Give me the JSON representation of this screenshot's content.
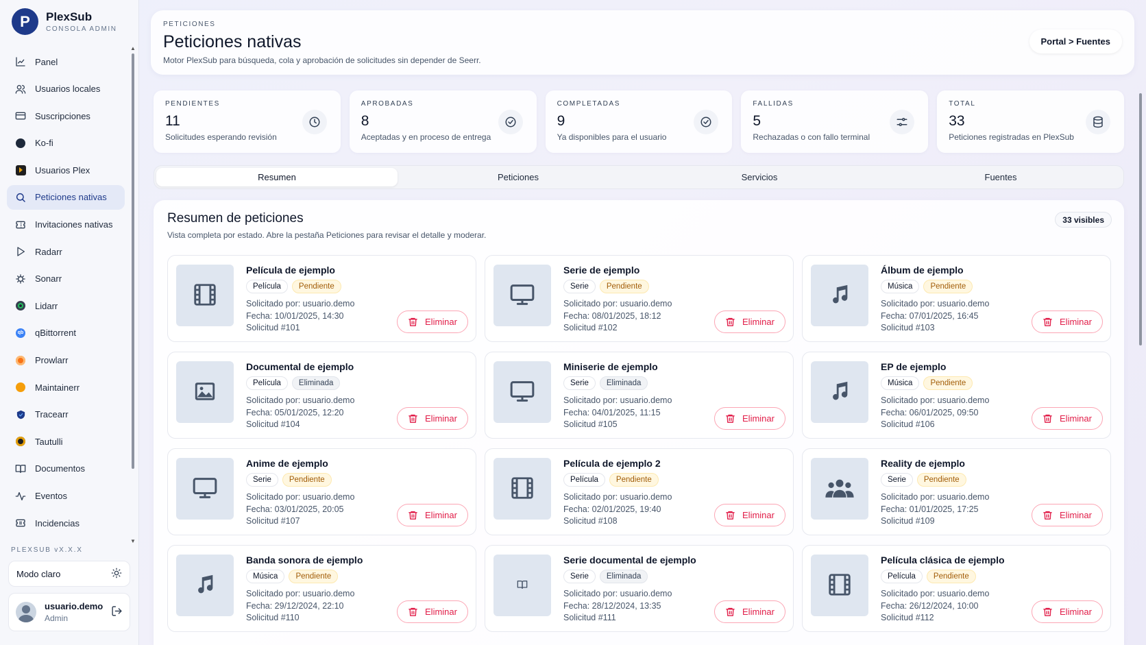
{
  "brand": {
    "name": "PlexSub",
    "subtitle": "CONSOLA ADMIN",
    "logo_letter": "P"
  },
  "sidebar": {
    "items": [
      {
        "label": "Panel",
        "icon": "chart-line-icon"
      },
      {
        "label": "Usuarios locales",
        "icon": "users-icon"
      },
      {
        "label": "Suscripciones",
        "icon": "credit-card-icon"
      },
      {
        "label": "Ko-fi",
        "icon": "kofi-icon"
      },
      {
        "label": "Usuarios Plex",
        "icon": "plex-icon"
      },
      {
        "label": "Peticiones nativas",
        "icon": "search-icon",
        "active": true
      },
      {
        "label": "Invitaciones nativas",
        "icon": "ticket-icon"
      },
      {
        "label": "Radarr",
        "icon": "radarr-icon"
      },
      {
        "label": "Sonarr",
        "icon": "sonarr-icon"
      },
      {
        "label": "Lidarr",
        "icon": "lidarr-icon"
      },
      {
        "label": "qBittorrent",
        "icon": "qbittorrent-icon"
      },
      {
        "label": "Prowlarr",
        "icon": "prowlarr-icon"
      },
      {
        "label": "Maintainerr",
        "icon": "maintainerr-icon"
      },
      {
        "label": "Tracearr",
        "icon": "tracearr-icon"
      },
      {
        "label": "Tautulli",
        "icon": "tautulli-icon"
      },
      {
        "label": "Documentos",
        "icon": "book-icon"
      },
      {
        "label": "Eventos",
        "icon": "activity-icon"
      },
      {
        "label": "Incidencias",
        "icon": "ticket-alert-icon"
      }
    ],
    "version": "PLEXSUB vX.X.X",
    "theme_label": "Modo claro",
    "user": {
      "name": "usuario.demo",
      "role": "Admin"
    }
  },
  "header": {
    "eyebrow": "PETICIONES",
    "title": "Peticiones nativas",
    "description": "Motor PlexSub para búsqueda, cola y aprobación de solicitudes sin depender de Seerr.",
    "crumb": "Portal > Fuentes"
  },
  "stats": [
    {
      "label": "PENDIENTES",
      "value": "11",
      "desc": "Solicitudes esperando revisión",
      "icon": "clock-icon"
    },
    {
      "label": "APROBADAS",
      "value": "8",
      "desc": "Aceptadas y en proceso de entrega",
      "icon": "check-circle-icon"
    },
    {
      "label": "COMPLETADAS",
      "value": "9",
      "desc": "Ya disponibles para el usuario",
      "icon": "check-circle-icon"
    },
    {
      "label": "FALLIDAS",
      "value": "5",
      "desc": "Rechazadas o con fallo terminal",
      "icon": "sliders-icon"
    },
    {
      "label": "TOTAL",
      "value": "33",
      "desc": "Peticiones registradas en PlexSub",
      "icon": "database-icon"
    }
  ],
  "tabs": [
    "Resumen",
    "Peticiones",
    "Servicios",
    "Fuentes"
  ],
  "summary": {
    "title": "Resumen de peticiones",
    "description": "Vista completa por estado. Abre la pestaña Peticiones para revisar el detalle y moderar.",
    "count": "33 visibles",
    "delete_label": "Eliminar",
    "cards": [
      {
        "title": "Película de ejemplo",
        "type": "Película",
        "status": "Pendiente",
        "requested": "Solicitado por: usuario.demo",
        "date": "Fecha: 10/01/2025, 14:30",
        "id": "Solicitud #101",
        "icon": "film-icon"
      },
      {
        "title": "Serie de ejemplo",
        "type": "Serie",
        "status": "Pendiente",
        "requested": "Solicitado por: usuario.demo",
        "date": "Fecha: 08/01/2025, 18:12",
        "id": "Solicitud #102",
        "icon": "monitor-icon"
      },
      {
        "title": "Álbum de ejemplo",
        "type": "Música",
        "status": "Pendiente",
        "requested": "Solicitado por: usuario.demo",
        "date": "Fecha: 07/01/2025, 16:45",
        "id": "Solicitud #103",
        "icon": "music-icon"
      },
      {
        "title": "Documental de ejemplo",
        "type": "Película",
        "status": "Eliminada",
        "requested": "Solicitado por: usuario.demo",
        "date": "Fecha: 05/01/2025, 12:20",
        "id": "Solicitud #104",
        "icon": "image-icon"
      },
      {
        "title": "Miniserie de ejemplo",
        "type": "Serie",
        "status": "Eliminada",
        "requested": "Solicitado por: usuario.demo",
        "date": "Fecha: 04/01/2025, 11:15",
        "id": "Solicitud #105",
        "icon": "monitor-icon"
      },
      {
        "title": "EP de ejemplo",
        "type": "Música",
        "status": "Pendiente",
        "requested": "Solicitado por: usuario.demo",
        "date": "Fecha: 06/01/2025, 09:50",
        "id": "Solicitud #106",
        "icon": "music-icon"
      },
      {
        "title": "Anime de ejemplo",
        "type": "Serie",
        "status": "Pendiente",
        "requested": "Solicitado por: usuario.demo",
        "date": "Fecha: 03/01/2025, 20:05",
        "id": "Solicitud #107",
        "icon": "monitor-icon"
      },
      {
        "title": "Película de ejemplo 2",
        "type": "Película",
        "status": "Pendiente",
        "requested": "Solicitado por: usuario.demo",
        "date": "Fecha: 02/01/2025, 19:40",
        "id": "Solicitud #108",
        "icon": "film-icon"
      },
      {
        "title": "Reality de ejemplo",
        "type": "Serie",
        "status": "Pendiente",
        "requested": "Solicitado por: usuario.demo",
        "date": "Fecha: 01/01/2025, 17:25",
        "id": "Solicitud #109",
        "icon": "people-icon"
      },
      {
        "title": "Banda sonora de ejemplo",
        "type": "Música",
        "status": "Pendiente",
        "requested": "Solicitado por: usuario.demo",
        "date": "Fecha: 29/12/2024, 22:10",
        "id": "Solicitud #110",
        "icon": "music-icon"
      },
      {
        "title": "Serie documental de ejemplo",
        "type": "Serie",
        "status": "Eliminada",
        "requested": "Solicitado por: usuario.demo",
        "date": "Fecha: 28/12/2024, 13:35",
        "id": "Solicitud #111",
        "icon": "book-icon"
      },
      {
        "title": "Película clásica de ejemplo",
        "type": "Película",
        "status": "Pendiente",
        "requested": "Solicitado por: usuario.demo",
        "date": "Fecha: 26/12/2024, 10:00",
        "id": "Solicitud #112",
        "icon": "film-icon"
      }
    ]
  },
  "colors": {
    "accent": "#1e3a8a",
    "danger": "#e11d48",
    "pending_bg": "#fff7e0"
  }
}
